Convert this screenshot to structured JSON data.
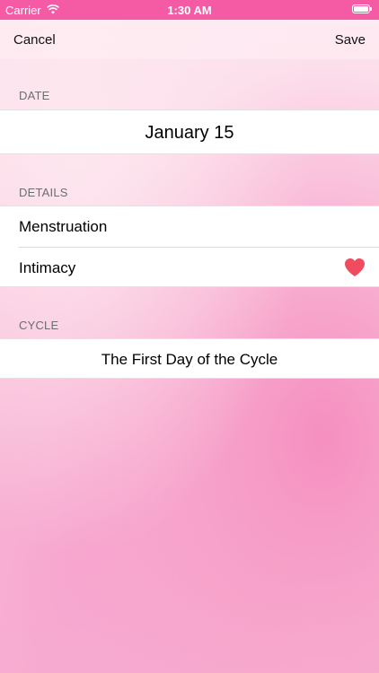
{
  "status_bar": {
    "carrier": "Carrier",
    "time": "1:30 AM"
  },
  "nav": {
    "cancel_label": "Cancel",
    "save_label": "Save"
  },
  "sections": {
    "date": {
      "header": "DATE",
      "value": "January 15"
    },
    "details": {
      "header": "DETAILS",
      "items": [
        "Menstruation",
        "Intimacy"
      ]
    },
    "cycle": {
      "header": "CYCLE",
      "value": "The First Day of the Cycle"
    }
  },
  "colors": {
    "status_bar": "#f45ba4",
    "heart": "#f04b5e"
  }
}
